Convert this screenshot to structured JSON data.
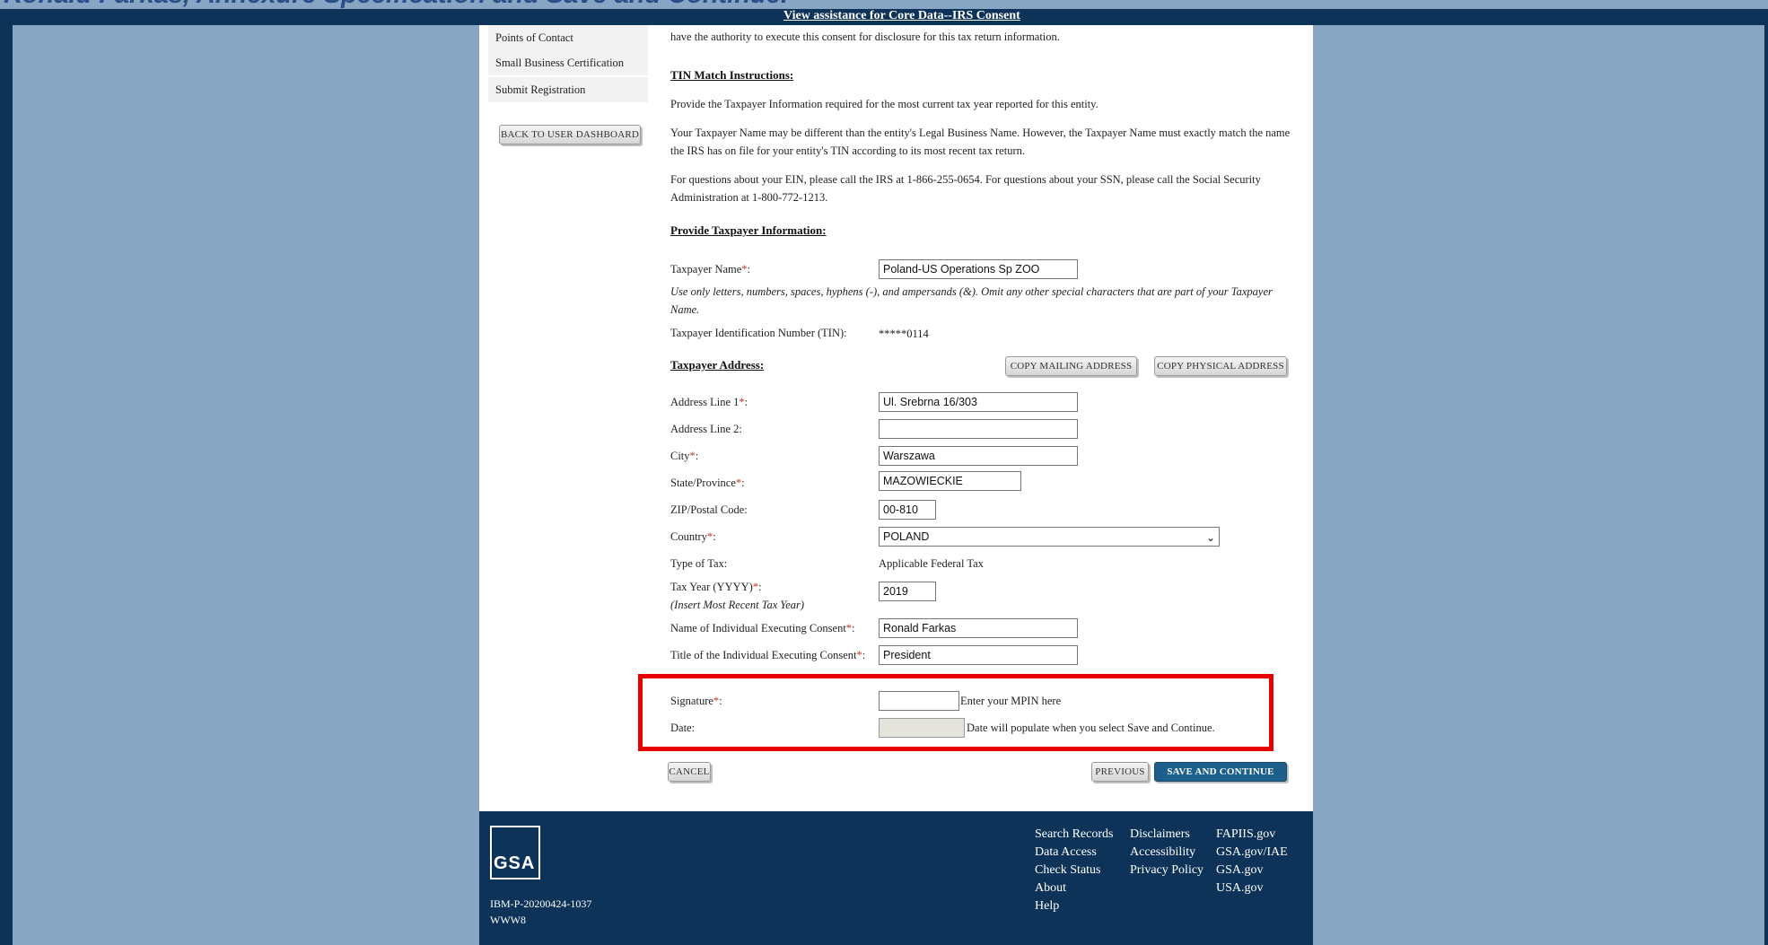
{
  "caption": "Ronald Farkas, Annexure Specification and Save and Continue.",
  "top_bar": {
    "link": "View assistance for Core Data--IRS Consent"
  },
  "sidebar": {
    "items": [
      "Points of Contact",
      "Small Business Certification",
      "Submit Registration"
    ],
    "back_button": "BACK TO USER DASHBOARD"
  },
  "content": {
    "consent_tail": "have the authority to execute this consent for disclosure for this tax return information.",
    "tin_heading": "TIN Match Instructions:",
    "p1": "Provide the Taxpayer Information required for the most current tax year reported for this entity.",
    "p2": "Your Taxpayer Name may be different than the entity's Legal Business Name. However, the Taxpayer Name must exactly match the name the IRS has on file for your entity's TIN according to its most recent tax return.",
    "p3": "For questions about your EIN, please call the IRS at 1-866-255-0654. For questions about your SSN, please call the Social Security Administration at 1-800-772-1213.",
    "provide_heading": "Provide Taxpayer Information:",
    "taxpayer_name_label": "Taxpayer Name",
    "taxpayer_name_value": "Poland-US Operations Sp ZOO",
    "name_hint": "Use only letters, numbers, spaces, hyphens (-), and ampersands (&). Omit any other special characters that are part of your Taxpayer Name.",
    "tin_label": "Taxpayer Identification Number (TIN):",
    "tin_value": "*****0114",
    "address_heading": "Taxpayer Address:",
    "copy_mailing": "COPY MAILING ADDRESS",
    "copy_physical": "COPY PHYSICAL ADDRESS",
    "address1_label": "Address Line 1",
    "address1_value": "Ul. Srebrna 16/303",
    "address2_label": "Address Line 2:",
    "address2_value": "",
    "city_label": "City",
    "city_value": "Warszawa",
    "state_label": "State/Province",
    "state_value": "MAZOWIECKIE",
    "zip_label": "ZIP/Postal Code:",
    "zip_value": "00-810",
    "country_label": "Country",
    "country_value": "POLAND",
    "tax_type_label": "Type of Tax:",
    "tax_type_value": "Applicable Federal Tax",
    "tax_year_label": "Tax Year (YYYY)",
    "tax_year_hint": "(Insert Most Recent Tax Year)",
    "tax_year_value": "2019",
    "exec_name_label": "Name of Individual Executing Consent",
    "exec_name_value": "Ronald Farkas",
    "exec_title_label": "Title of the Individual Executing Consent",
    "exec_title_value": "President",
    "signature_label": "Signature",
    "signature_hint": "Enter your MPIN here",
    "signature_value": "",
    "date_label": "Date:",
    "date_hint": "Date will populate when you select Save and Continue.",
    "date_value": "",
    "cancel": "CANCEL",
    "previous": "PREVIOUS",
    "save_continue": "SAVE AND CONTINUE",
    "required_mark": "*",
    "colon": ":"
  },
  "footer": {
    "logo_text": "GSA",
    "build_id": "IBM-P-20200424-1037",
    "server": "WWW8",
    "col1": [
      "Search Records",
      "Data Access",
      "Check Status",
      "About",
      "Help"
    ],
    "col2": [
      "Disclaimers",
      "Accessibility",
      "Privacy Policy"
    ],
    "col3": [
      "FAPIIS.gov",
      "GSA.gov/IAE",
      "GSA.gov",
      "USA.gov"
    ]
  },
  "colors": {
    "header_bg": "#0e3358",
    "page_bg": "#88a6c4",
    "highlight": "#e60000",
    "primary_button": "#1c5f8a"
  }
}
